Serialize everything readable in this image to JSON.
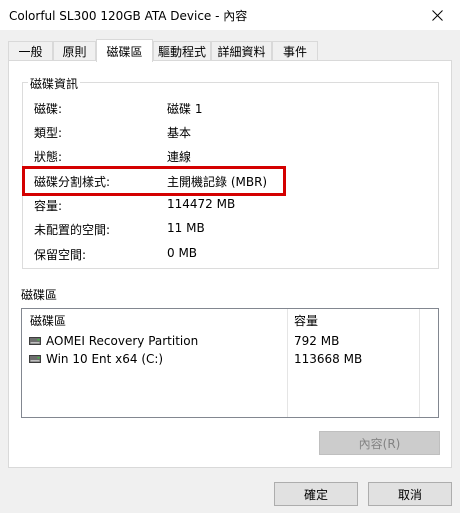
{
  "window": {
    "title": "Colorful SL300 120GB ATA Device - 內容"
  },
  "tabs": [
    {
      "label": "一般",
      "active": false
    },
    {
      "label": "原則",
      "active": false
    },
    {
      "label": "磁碟區",
      "active": true
    },
    {
      "label": "驅動程式",
      "active": false
    },
    {
      "label": "詳細資料",
      "active": false
    },
    {
      "label": "事件",
      "active": false
    }
  ],
  "disk_info": {
    "group_title": "磁碟資訊",
    "rows": [
      {
        "label": "磁碟:",
        "value": "磁碟 1"
      },
      {
        "label": "類型:",
        "value": "基本"
      },
      {
        "label": "狀態:",
        "value": "連線"
      },
      {
        "label": "磁碟分割樣式:",
        "value": "主開機記錄 (MBR)"
      },
      {
        "label": "容量:",
        "value": "114472 MB"
      },
      {
        "label": "未配置的空間:",
        "value": "11 MB"
      },
      {
        "label": "保留空間:",
        "value": "0 MB"
      }
    ]
  },
  "volumes": {
    "group_title": "磁碟區",
    "columns": [
      "磁碟區",
      "容量"
    ],
    "items": [
      {
        "name": "AOMEI Recovery Partition",
        "capacity": "792 MB",
        "icon": "drive-icon"
      },
      {
        "name": "Win 10 Ent x64 (C:)",
        "capacity": "113668 MB",
        "icon": "drive-icon"
      }
    ],
    "properties_button": "內容(R)"
  },
  "footer": {
    "ok_label": "確定",
    "cancel_label": "取消"
  },
  "colors": {
    "highlight": "#d40000",
    "disabled_button": "#cccccc"
  }
}
